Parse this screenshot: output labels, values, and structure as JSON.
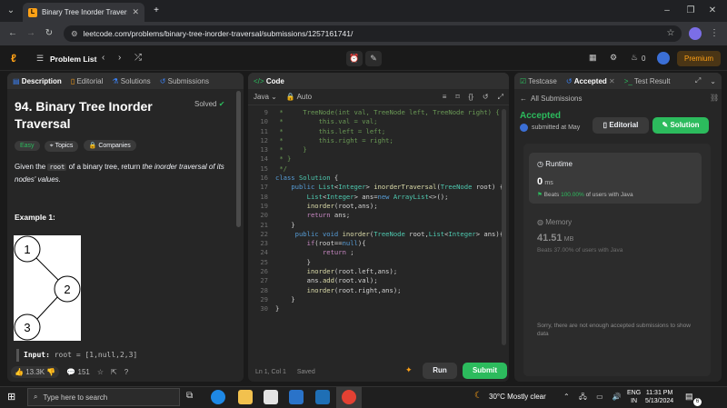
{
  "browser": {
    "tab_title": "Binary Tree Inorder Traversal - L",
    "url": "leetcode.com/problems/binary-tree-inorder-traversal/submissions/1257161741/"
  },
  "lc_top": {
    "problem_list": "Problem List",
    "streak": "0",
    "premium": "Premium"
  },
  "left": {
    "tabs": [
      "Description",
      "Editorial",
      "Solutions",
      "Submissions"
    ],
    "title": "94. Binary Tree Inorder Traversal",
    "solved": "Solved",
    "chips": [
      "Easy",
      "Topics",
      "Companies"
    ],
    "desc_1": "Given the",
    "desc_code": "root",
    "desc_2": "of a binary tree, return",
    "desc_em": "the inorder traversal of its nodes' values.",
    "example": "Example 1:",
    "tree_nodes": [
      "1",
      "2",
      "3"
    ],
    "input_label": "Input:",
    "input_value": "root = [1,null,2,3]",
    "likes": "13.3K",
    "comments": "151"
  },
  "code": {
    "tab": "Code",
    "lang": "Java",
    "mode": "Auto",
    "status": "Ln 1, Col 1",
    "saved": "Saved",
    "run": "Run",
    "submit": "Submit"
  },
  "right": {
    "tabs": [
      "Testcase",
      "Accepted",
      "Test Result"
    ],
    "back": "All Submissions",
    "verdict": "Accepted",
    "submitted": "submitted at May",
    "editorial": "Editorial",
    "solution": "Solution",
    "runtime_label": "Runtime",
    "runtime_value": "0",
    "runtime_unit": "ms",
    "runtime_beats_pre": "Beats",
    "runtime_beats": "100.00%",
    "runtime_beats_post": "of users with Java",
    "memory_label": "Memory",
    "memory_value": "41.51",
    "memory_unit": "MB",
    "memory_beats_pre": "Beats",
    "memory_beats": "37.00%",
    "memory_beats_post": "of users with Java",
    "not_enough": "Sorry, there are not enough accepted submissions to show data"
  },
  "taskbar": {
    "search": "Type here to search",
    "weather": "30°C  Mostly clear",
    "lang1": "ENG",
    "lang2": "IN",
    "time": "11:31 PM",
    "date": "5/13/2024",
    "notif": "6"
  }
}
